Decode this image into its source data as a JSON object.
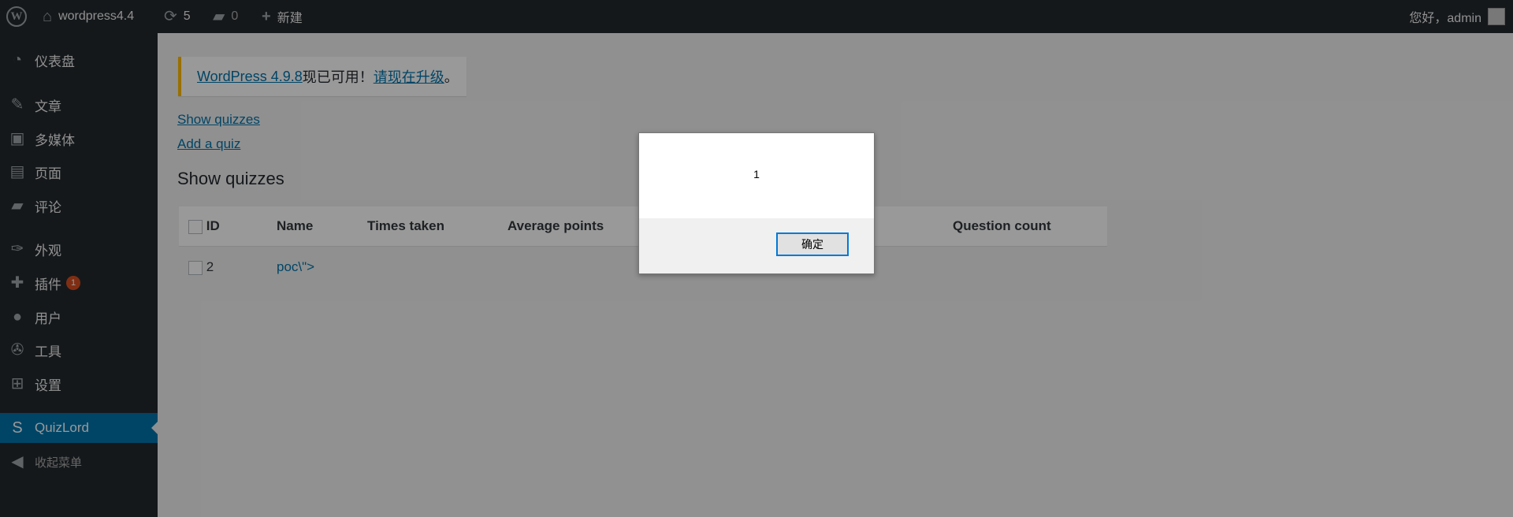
{
  "adminbar": {
    "site_name": "wordpress4.4",
    "updates_count": "5",
    "comments_count": "0",
    "new_label": "新建",
    "greeting": "您好，admin",
    "icons": {
      "logo": "wordpress-logo-icon",
      "home": "home-icon",
      "updates": "refresh-icon",
      "comments": "comment-icon",
      "new": "plus-icon"
    }
  },
  "sidebar": {
    "items": [
      {
        "label": "仪表盘",
        "icon": "dashboard-icon"
      },
      {
        "label": "文章",
        "icon": "pin-icon"
      },
      {
        "label": "多媒体",
        "icon": "media-icon"
      },
      {
        "label": "页面",
        "icon": "page-icon"
      },
      {
        "label": "评论",
        "icon": "comment-icon"
      },
      {
        "label": "外观",
        "icon": "brush-icon"
      },
      {
        "label": "插件",
        "icon": "plugin-icon",
        "badge": "1"
      },
      {
        "label": "用户",
        "icon": "user-icon"
      },
      {
        "label": "工具",
        "icon": "wrench-icon"
      },
      {
        "label": "设置",
        "icon": "settings-icon"
      },
      {
        "label": "QuizLord",
        "icon": "quizlord-icon",
        "current": true
      }
    ],
    "collapse_label": "收起菜单"
  },
  "main": {
    "notice": {
      "version_link": "WordPress 4.9.8",
      "middle_text": "现已可用！",
      "upgrade_link": "请现在升级",
      "end": "。",
      "accent": "#ffb900"
    },
    "show_quizzes_link": "Show quizzes",
    "add_quiz_link": "Add a quiz",
    "title": "Show quizzes",
    "table": {
      "columns": [
        "ID",
        "Name",
        "Times taken",
        "Average points",
        "",
        "Question count"
      ],
      "rows": [
        {
          "id": "2",
          "name": "poc\\\">"
        }
      ]
    }
  },
  "dialog": {
    "message": "1",
    "ok_label": "确定"
  },
  "colors": {
    "adminbar": "#23282d",
    "current": "#0073aa",
    "link": "#0073aa",
    "badge": "#d54e21"
  }
}
